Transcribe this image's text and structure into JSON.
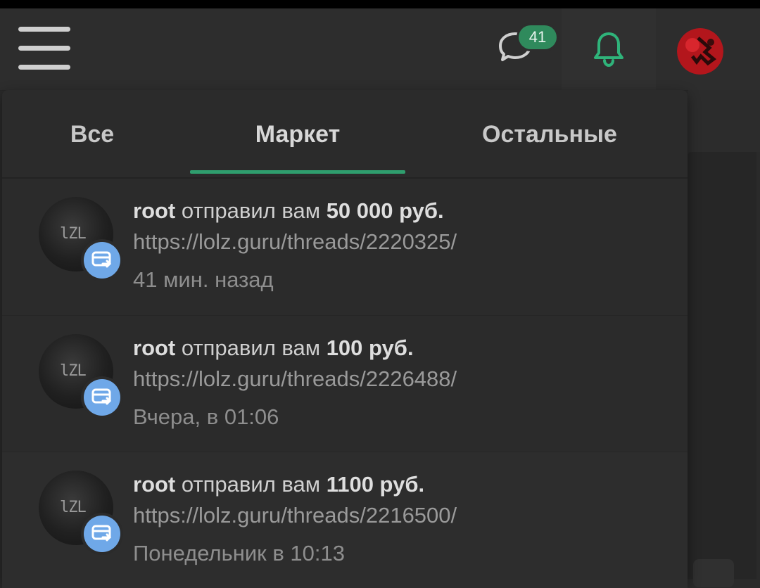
{
  "header": {
    "conversations_badge": "41"
  },
  "tabs": [
    {
      "label": "Все"
    },
    {
      "label": "Маркет"
    },
    {
      "label": "Остальные"
    }
  ],
  "active_tab": "Маркет",
  "notifications": [
    {
      "user": "root",
      "action": " отправил вам ",
      "amount": "50 000 руб.",
      "link": "https://lolz.guru/threads/2220325/",
      "time": "41 мин. назад"
    },
    {
      "user": "root",
      "action": " отправил вам ",
      "amount": "100 руб.",
      "link": "https://lolz.guru/threads/2226488/",
      "time": "Вчера, в 01:06"
    },
    {
      "user": "root",
      "action": " отправил вам ",
      "amount": "1100 руб.",
      "link": "https://lolz.guru/threads/2216500/",
      "time": "Понедельник в 10:13"
    }
  ],
  "colors": {
    "accent": "#2f9e6e",
    "badge": "#2f8a5c",
    "transfer_badge": "#6fa8e8"
  }
}
